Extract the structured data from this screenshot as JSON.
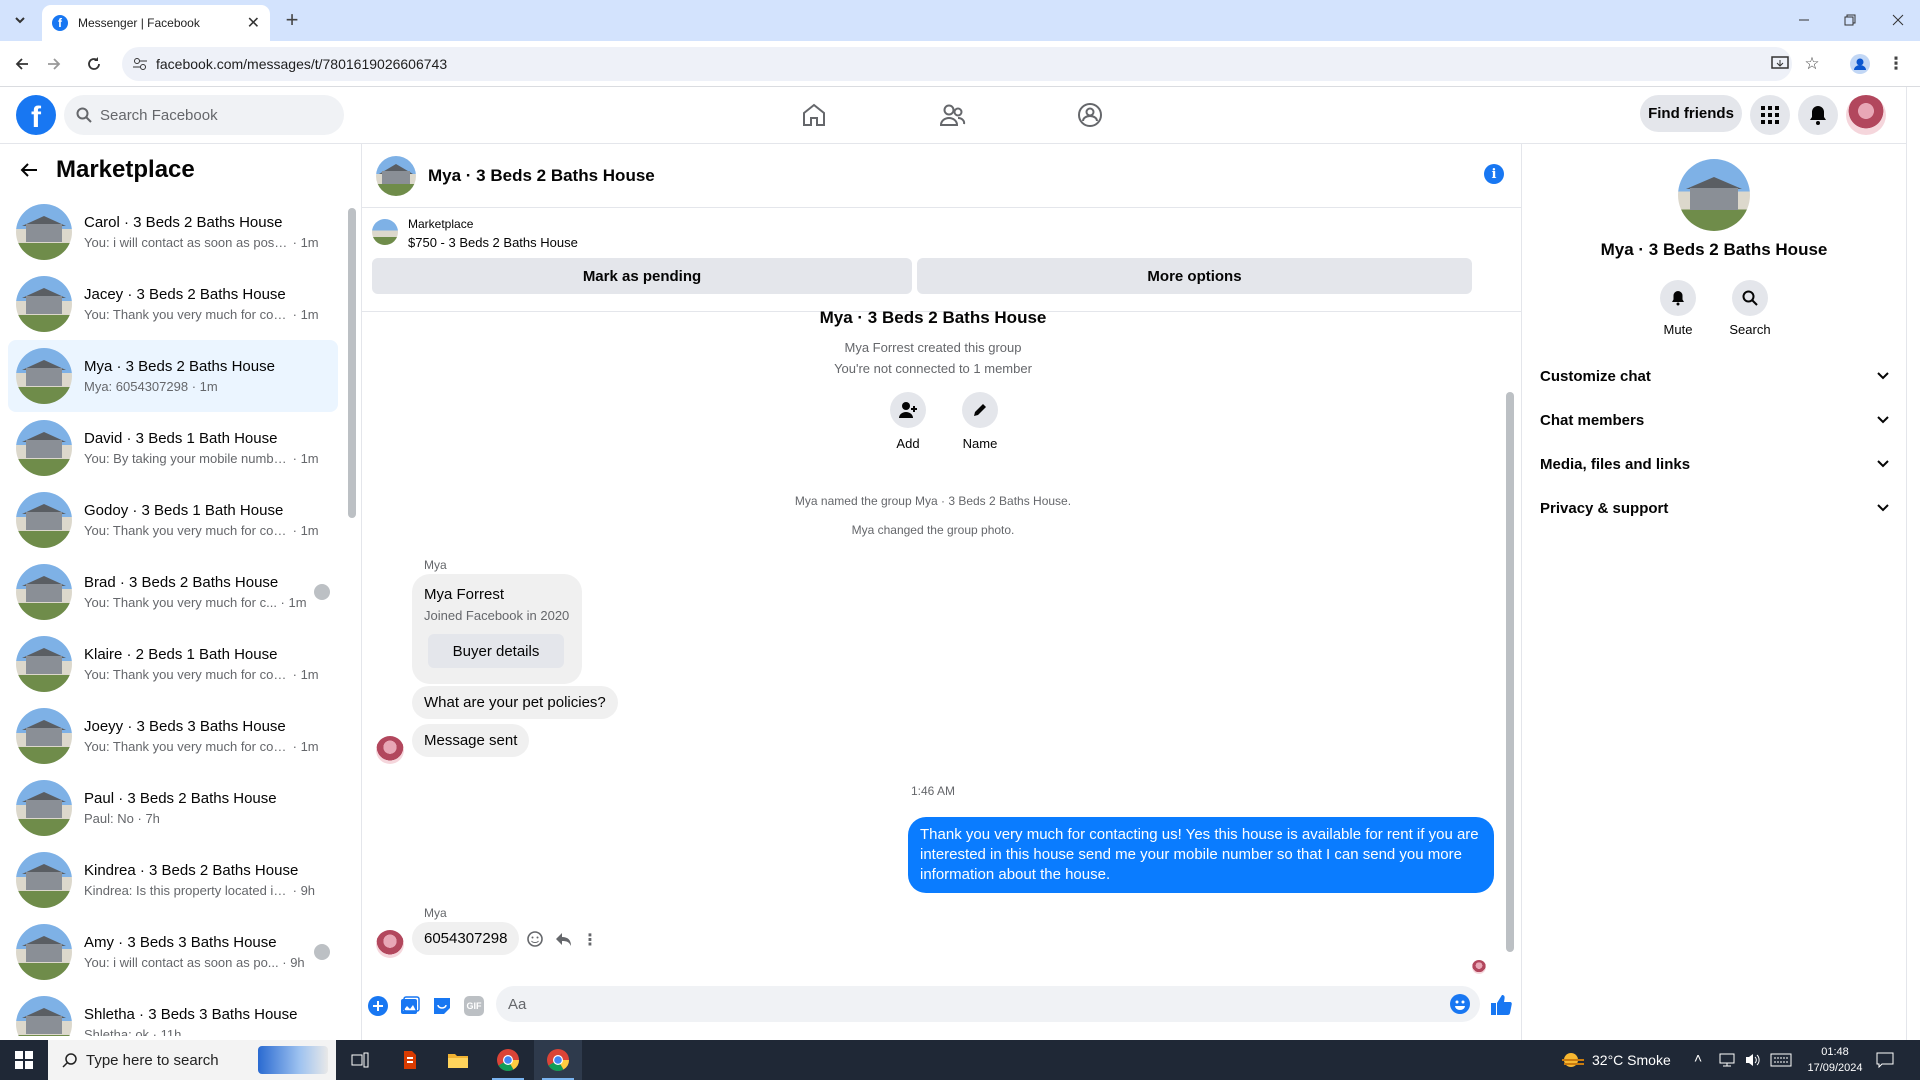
{
  "browser": {
    "tab_title": "Messenger | Facebook",
    "url": "facebook.com/messages/t/7801619026606743"
  },
  "fb": {
    "search_placeholder": "Search Facebook",
    "find_friends": "Find friends"
  },
  "sidebar": {
    "title": "Marketplace",
    "conversations": [
      {
        "name": "Carol · 3 Beds 2 Baths House",
        "preview": "You: i will contact as soon as possi...",
        "time": "1m"
      },
      {
        "name": "Jacey · 3 Beds 2 Baths House",
        "preview": "You: Thank you very much for cont...",
        "time": "1m"
      },
      {
        "name": "Mya · 3 Beds 2 Baths House",
        "preview": "Mya: 6054307298",
        "time": "1m"
      },
      {
        "name": "David · 3 Beds 1 Bath House",
        "preview": "You: By taking your mobile numbe...",
        "time": "1m"
      },
      {
        "name": "Godoy · 3 Beds 1 Bath House",
        "preview": "You: Thank you very much for cont...",
        "time": "1m"
      },
      {
        "name": "Brad · 3 Beds 2 Baths House",
        "preview": "You: Thank you very much for c...",
        "time": "1m"
      },
      {
        "name": "Klaire · 2 Beds 1 Bath House",
        "preview": "You: Thank you very much for cont...",
        "time": "1m"
      },
      {
        "name": "Joeyy · 3 Beds 3 Baths House",
        "preview": "You: Thank you very much for cont...",
        "time": "1m"
      },
      {
        "name": "Paul · 3 Beds 2 Baths House",
        "preview": "Paul: No",
        "time": "7h"
      },
      {
        "name": "Kindrea · 3 Beds 2 Baths House",
        "preview": "Kindrea: Is this property located in ...",
        "time": "9h"
      },
      {
        "name": "Amy · 3 Beds 3 Baths House",
        "preview": "You: i will contact as soon as po...",
        "time": "9h"
      },
      {
        "name": "Shletha · 3 Beds 3 Baths House",
        "preview": "Shletha: ok",
        "time": "11h"
      }
    ]
  },
  "chat": {
    "title": "Mya · 3 Beds 2 Baths House",
    "marketplace_label": "Marketplace",
    "listing": "$750 - 3 Beds 2 Baths House",
    "mark_pending": "Mark as pending",
    "more_options": "More options",
    "group_title": "Mya · 3 Beds 2 Baths House",
    "created": "Mya Forrest created this group",
    "not_connected": "You're not connected to 1 member",
    "add_label": "Add",
    "name_label": "Name",
    "event1": "Mya named the group Mya · 3 Beds 2 Baths House.",
    "event2": "Mya changed the group photo.",
    "sender_short": "Mya",
    "card_name": "Mya Forrest",
    "card_joined": "Joined Facebook in 2020",
    "buyer_details": "Buyer details",
    "msg_pet": "What are your pet policies?",
    "msg_sent": "Message sent",
    "timestamp": "1:46 AM",
    "msg_out": "Thank you very much for contacting us! Yes this house is available for rent if you are interested in this house send me your mobile number so that I can send you more information about the house.",
    "sender_short2": "Mya",
    "msg_phone": "6054307298",
    "input_placeholder": "Aa"
  },
  "info": {
    "title": "Mya · 3 Beds 2 Baths House",
    "mute": "Mute",
    "search": "Search",
    "sections": [
      "Customize chat",
      "Chat members",
      "Media, files and links",
      "Privacy & support"
    ]
  },
  "taskbar": {
    "search_placeholder": "Type here to search",
    "weather": "32°C  Smoke",
    "time": "01:48",
    "date": "17/09/2024"
  },
  "colors": {
    "accent": "#1877f2",
    "bubble_out": "#0a7cff",
    "bubble_in": "#f0f0f0"
  }
}
